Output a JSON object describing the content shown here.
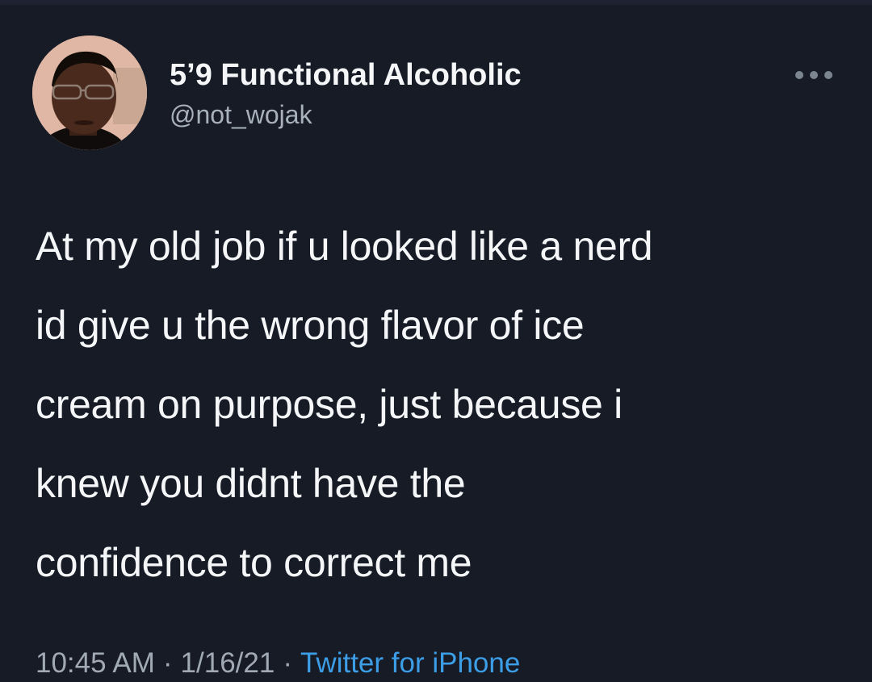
{
  "user": {
    "display_name": "5’9 Functional Alcoholic",
    "handle": "@not_wojak"
  },
  "tweet": {
    "lines": [
      "At my old job if u looked like a nerd",
      "id give u the wrong flavor of ice",
      "cream on purpose, just because i",
      "knew you didnt have the",
      "confidence to correct me"
    ]
  },
  "meta": {
    "time": "10:45 AM",
    "separator": "·",
    "date": "1/16/21",
    "source": "Twitter for iPhone"
  },
  "icons": {
    "more": "more-horizontal-icon",
    "avatar": "profile-photo"
  },
  "colors": {
    "background": "#161b26",
    "text": "#f4f6f8",
    "muted": "#a0a9b4",
    "link": "#3d9ee8"
  }
}
